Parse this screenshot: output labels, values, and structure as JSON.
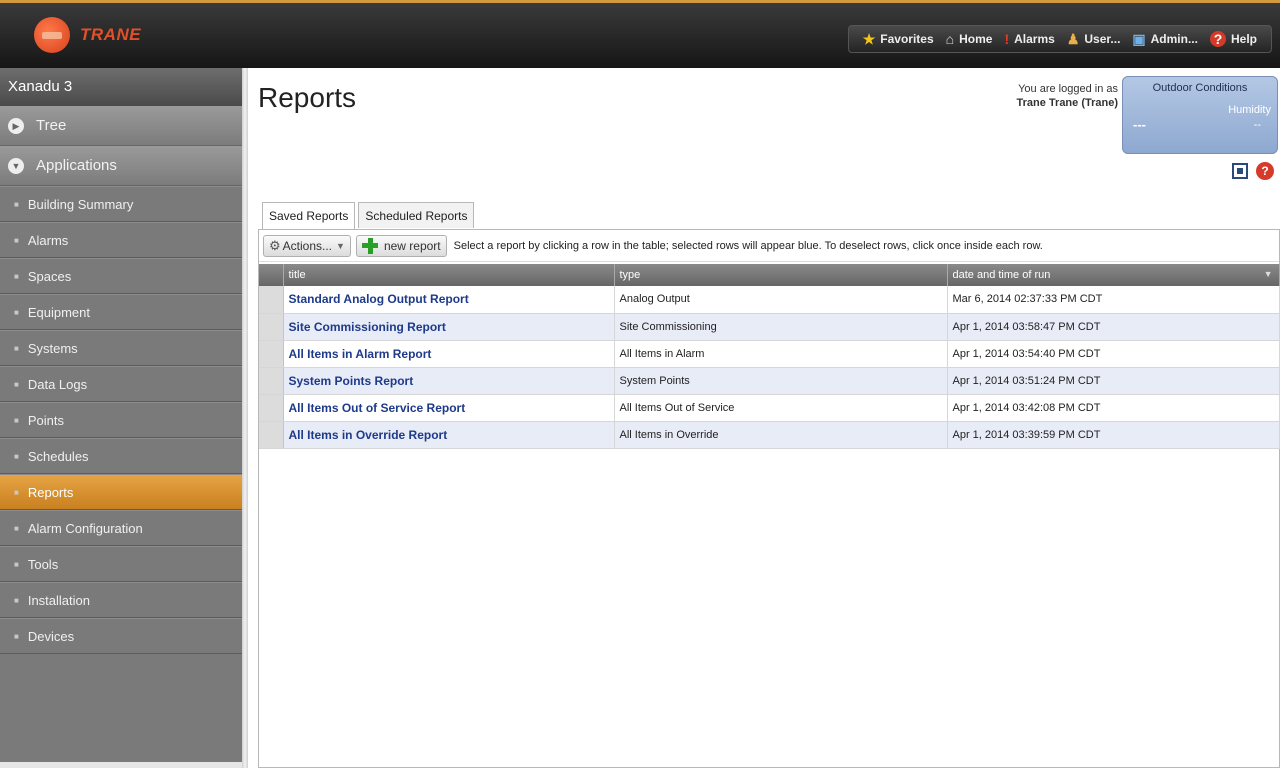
{
  "brand": {
    "name": "TRANE"
  },
  "topnav": {
    "favorites": "Favorites",
    "home": "Home",
    "alarms": "Alarms",
    "user": "User...",
    "admin": "Admin...",
    "help": "Help"
  },
  "sidebar": {
    "site_name": "Xanadu 3",
    "tree": "Tree",
    "applications": "Applications",
    "items": [
      {
        "label": "Building Summary"
      },
      {
        "label": "Alarms"
      },
      {
        "label": "Spaces"
      },
      {
        "label": "Equipment"
      },
      {
        "label": "Systems"
      },
      {
        "label": "Data Logs"
      },
      {
        "label": "Points"
      },
      {
        "label": "Schedules"
      },
      {
        "label": "Reports"
      },
      {
        "label": "Alarm Configuration"
      },
      {
        "label": "Tools"
      },
      {
        "label": "Installation"
      },
      {
        "label": "Devices"
      }
    ],
    "active_index": 8
  },
  "main": {
    "title": "Reports",
    "login_prefix": "You are logged in as",
    "login_user": "Trane Trane (Trane)",
    "outdoor": {
      "title": "Outdoor Conditions",
      "humidity_label": "Humidity",
      "temp_value": "---",
      "humidity_value": "--"
    },
    "tabs": [
      {
        "label": "Saved Reports"
      },
      {
        "label": "Scheduled Reports"
      }
    ],
    "actions_label": "Actions...",
    "new_report_label": "new report",
    "hint": "Select a report by clicking a row in the table; selected rows will appear blue. To deselect rows, click once inside each row.",
    "columns": {
      "title": "title",
      "type": "type",
      "date": "date and time of run"
    },
    "rows": [
      {
        "title": "Standard Analog Output Report",
        "type": "Analog Output",
        "date": "Mar 6, 2014 02:37:33 PM CDT"
      },
      {
        "title": "Site Commissioning Report",
        "type": "Site Commissioning",
        "date": "Apr 1, 2014 03:58:47 PM CDT"
      },
      {
        "title": "All Items in Alarm Report",
        "type": "All Items in Alarm",
        "date": "Apr 1, 2014 03:54:40 PM CDT"
      },
      {
        "title": "System Points Report",
        "type": "System Points",
        "date": "Apr 1, 2014 03:51:24 PM CDT"
      },
      {
        "title": "All Items Out of Service Report",
        "type": "All Items Out of Service",
        "date": "Apr 1, 2014 03:42:08 PM CDT"
      },
      {
        "title": "All Items in Override Report",
        "type": "All Items in Override",
        "date": "Apr 1, 2014 03:39:59 PM CDT"
      }
    ]
  }
}
